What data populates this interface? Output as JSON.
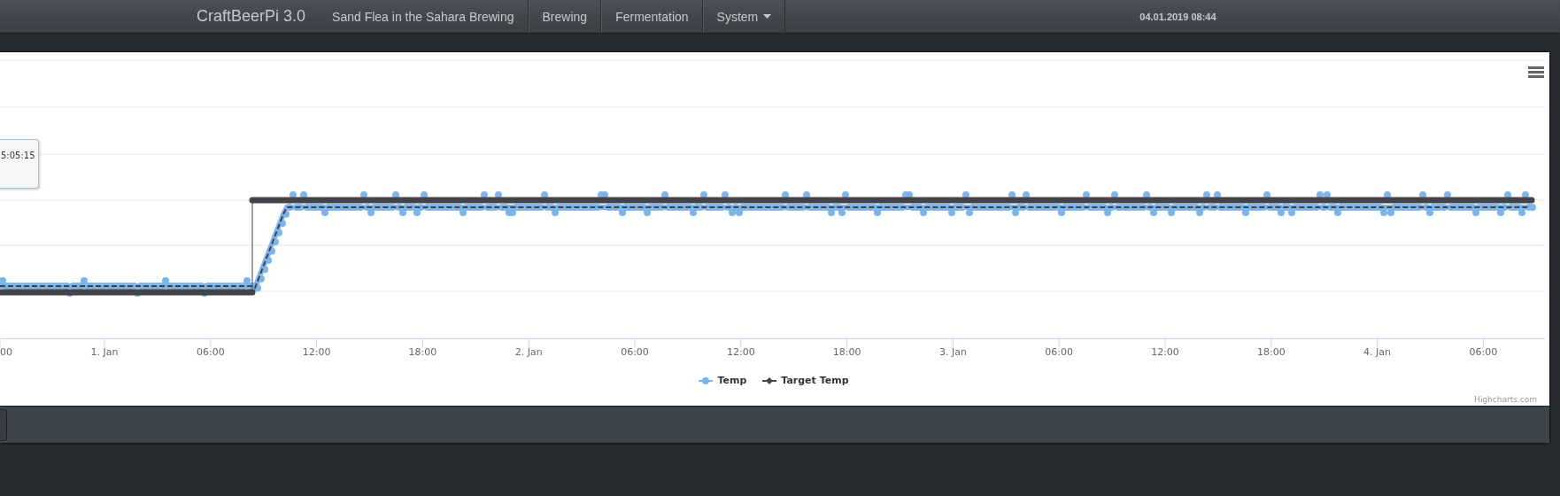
{
  "navbar": {
    "brand": "CraftBeerPi 3.0",
    "items": [
      {
        "label": "Sand Flea in the Sahara Brewing",
        "kind": "link"
      },
      {
        "label": "Brewing",
        "kind": "link"
      },
      {
        "label": "Fermentation",
        "kind": "link"
      },
      {
        "label": "System",
        "kind": "dropdown"
      }
    ],
    "clock": "04.01.2019 08:44"
  },
  "chart": {
    "tooltip": "5:05:15",
    "xticks": [
      "00",
      "1. Jan",
      "06:00",
      "12:00",
      "18:00",
      "2. Jan",
      "06:00",
      "12:00",
      "18:00",
      "3. Jan",
      "06:00",
      "12:00",
      "18:00",
      "4. Jan",
      "06:00"
    ],
    "legend": [
      {
        "name": "Temp",
        "color": "#7cb5ec"
      },
      {
        "name": "Target Temp",
        "color": "#434348"
      }
    ],
    "credits": "Highcharts.com"
  }
}
